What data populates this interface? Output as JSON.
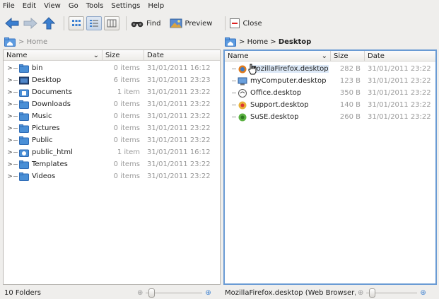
{
  "menu": [
    {
      "label": "File"
    },
    {
      "label": "Edit"
    },
    {
      "label": "View"
    },
    {
      "label": "Go"
    },
    {
      "label": "Tools"
    },
    {
      "label": "Settings"
    },
    {
      "label": "Help"
    }
  ],
  "toolbar": {
    "find_label": "Find",
    "preview_label": "Preview",
    "close_label": "Close"
  },
  "left_pane": {
    "breadcrumb": "Home",
    "columns": {
      "name": "Name",
      "size": "Size",
      "date": "Date"
    },
    "rows": [
      {
        "name": "bin",
        "size": "0 items",
        "date": "31/01/2011 16:12"
      },
      {
        "name": "Desktop",
        "size": "6 items",
        "date": "31/01/2011 23:23"
      },
      {
        "name": "Documents",
        "size": "1 item",
        "date": "31/01/2011 23:22"
      },
      {
        "name": "Downloads",
        "size": "0 items",
        "date": "31/01/2011 23:22"
      },
      {
        "name": "Music",
        "size": "0 items",
        "date": "31/01/2011 23:22"
      },
      {
        "name": "Pictures",
        "size": "0 items",
        "date": "31/01/2011 23:22"
      },
      {
        "name": "Public",
        "size": "0 items",
        "date": "31/01/2011 23:22"
      },
      {
        "name": "public_html",
        "size": "1 item",
        "date": "31/01/2011 16:12"
      },
      {
        "name": "Templates",
        "size": "0 items",
        "date": "31/01/2011 23:22"
      },
      {
        "name": "Videos",
        "size": "0 items",
        "date": "31/01/2011 23:22"
      }
    ],
    "status": "10 Folders"
  },
  "right_pane": {
    "breadcrumb_home": "Home",
    "breadcrumb_current": "Desktop",
    "columns": {
      "name": "Name",
      "size": "Size",
      "date": "Date"
    },
    "rows": [
      {
        "name": "MozillaFirefox.desktop",
        "size": "282 B",
        "date": "31/01/2011 23:22"
      },
      {
        "name": "myComputer.desktop",
        "size": "123 B",
        "date": "31/01/2011 23:22"
      },
      {
        "name": "Office.desktop",
        "size": "350 B",
        "date": "31/01/2011 23:22"
      },
      {
        "name": "Support.desktop",
        "size": "140 B",
        "date": "31/01/2011 23:22"
      },
      {
        "name": "SuSE.desktop",
        "size": "260 B",
        "date": "31/01/2011 23:22"
      }
    ],
    "status": "MozillaFirefox.desktop (Web Browser, 2"
  },
  "colors": {
    "folder": "#4a8fd6",
    "active_border": "#6a9bd4",
    "hover_row": "#dde9f7"
  }
}
